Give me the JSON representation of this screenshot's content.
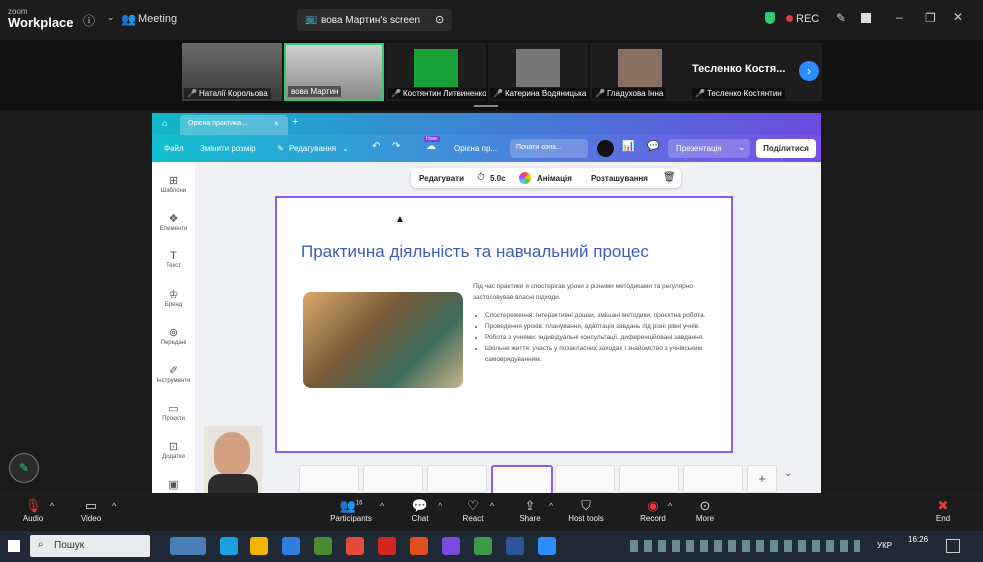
{
  "zoom": {
    "logo_small": "zoom",
    "logo_big": "Workplace",
    "meeting_label": "Meeting",
    "screen_label": "вова Мартин's screen",
    "rec_label": "REC",
    "participants": [
      {
        "name": "Наталії Корольова"
      },
      {
        "name": "вова Мартин"
      },
      {
        "name": "Костянтин Литвиненко"
      },
      {
        "name": "Катерина Водяницька"
      },
      {
        "name": "Гладухова Інна"
      },
      {
        "name": "Тесленко Костянтин"
      }
    ],
    "featured_name": "Тесленко Костя...",
    "bottom": {
      "audio": "Audio",
      "video": "Video",
      "participants": "Participants",
      "participants_count": "16",
      "chat": "Chat",
      "react": "React",
      "share": "Share",
      "host_tools": "Host tools",
      "record": "Record",
      "more": "More",
      "end": "End"
    }
  },
  "canva": {
    "tab_title": "Орієна практика...",
    "menu": {
      "file": "Файл",
      "resize": "Змінити розмір",
      "editing": "Редагування",
      "new_badge": "Нове",
      "doc_title": "Орієна пр...",
      "start_label": "Почати озна...",
      "presentation": "Презентація",
      "share": "Поділитися"
    },
    "sidebar": [
      {
        "label": "Шаблони"
      },
      {
        "label": "Елементи"
      },
      {
        "label": "Текст"
      },
      {
        "label": "Бренд"
      },
      {
        "label": "Передані"
      },
      {
        "label": "Інструменти"
      },
      {
        "label": "Проєкти"
      },
      {
        "label": "Додатки"
      }
    ],
    "float_toolbar": {
      "edit": "Редагувати",
      "duration": "5.0с",
      "animation": "Анімація",
      "position": "Розташування"
    },
    "slide": {
      "title": "Практична діяльність та навчальний процес",
      "intro": "Під час практики я спостерігав уроки з різними методиками та регулярно застосовував власні підходи.",
      "bullets": [
        "Спостереження: інтерактивні дошки, змішані методики, проєктна робота.",
        "Проведення уроків: планування, адаптація завдань під різні рівні учнів.",
        "Робота з учнями: індивідуальні консультації, диференційовані завдання.",
        "Шкільне життя: участь у позакласних заходах і знайомство з учнівським самоврядуванням."
      ]
    }
  },
  "taskbar": {
    "search": "Пошук",
    "lang": "УКР",
    "time": "16:26"
  }
}
